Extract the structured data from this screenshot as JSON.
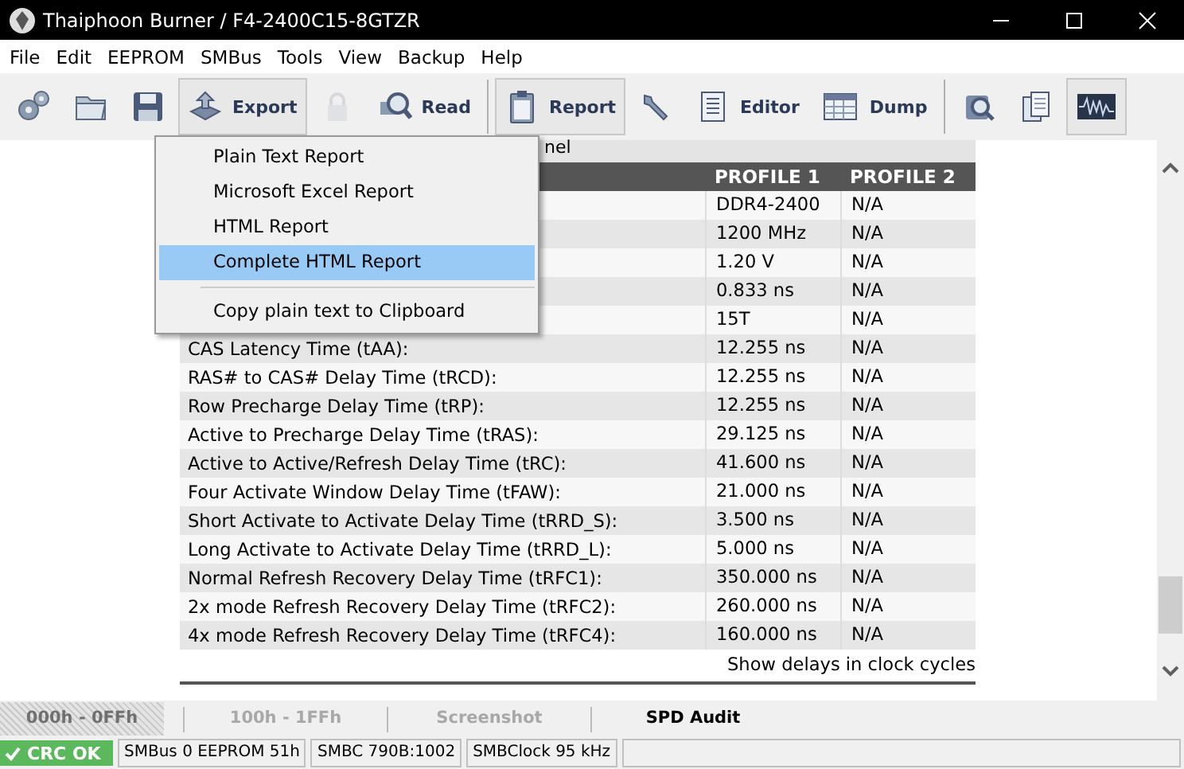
{
  "window": {
    "title": "Thaiphoon Burner / F4-2400C15-8GTZR"
  },
  "menu_bar": [
    "File",
    "Edit",
    "EEPROM",
    "SMBus",
    "Tools",
    "View",
    "Backup",
    "Help"
  ],
  "toolbar": [
    {
      "kind": "tool",
      "pressed": false,
      "disabled": false
    },
    {
      "kind": "tool",
      "pressed": false,
      "disabled": false
    },
    {
      "kind": "tool",
      "pressed": false,
      "disabled": false
    },
    {
      "kind": "labeled",
      "label": "Export",
      "pressed": true,
      "disabled": false
    },
    {
      "kind": "tool",
      "pressed": false,
      "disabled": true
    },
    {
      "kind": "labeled",
      "label": "Read",
      "pressed": false,
      "disabled": false
    },
    {
      "kind": "separator"
    },
    {
      "kind": "labeled",
      "label": "Report",
      "pressed": true,
      "disabled": false
    },
    {
      "kind": "tool",
      "pressed": false,
      "disabled": false
    },
    {
      "kind": "labeled",
      "label": "Editor",
      "pressed": false,
      "disabled": false
    },
    {
      "kind": "labeled",
      "label": "Dump",
      "pressed": false,
      "disabled": false
    },
    {
      "kind": "separator"
    },
    {
      "kind": "tool",
      "pressed": false,
      "disabled": false
    },
    {
      "kind": "tool",
      "pressed": false,
      "disabled": false
    },
    {
      "kind": "tool",
      "pressed": true,
      "disabled": false
    }
  ],
  "export_menu": [
    {
      "label": "Plain Text Report",
      "selected": false
    },
    {
      "label": "Microsoft Excel Report",
      "selected": false
    },
    {
      "label": "HTML Report",
      "selected": false
    },
    {
      "label": "Complete HTML Report",
      "selected": true
    },
    {
      "label": "Copy plain text to Clipboard",
      "selected": false,
      "separator_before": true
    }
  ],
  "report": {
    "section_title": "nel",
    "columns": [
      "PROFILE 1",
      "PROFILE 2"
    ],
    "rows": [
      {
        "profile_1": "DDR4-2400",
        "profile_2": "N/A"
      },
      {
        "profile_1": "1200 MHz",
        "profile_2": "N/A"
      },
      {
        "profile_1": "1.20 V",
        "profile_2": "N/A"
      },
      {
        "profile_1": "0.833 ns",
        "profile_2": "N/A"
      },
      {
        "profile_1": "15T",
        "profile_2": "N/A"
      },
      {
        "label": "CAS Latency Time (tAA):",
        "profile_1": "12.255 ns",
        "profile_2": "N/A"
      },
      {
        "label": "RAS# to CAS# Delay Time (tRCD):",
        "profile_1": "12.255 ns",
        "profile_2": "N/A"
      },
      {
        "label": "Row Precharge Delay Time (tRP):",
        "profile_1": "12.255 ns",
        "profile_2": "N/A"
      },
      {
        "label": "Active to Precharge Delay Time (tRAS):",
        "profile_1": "29.125 ns",
        "profile_2": "N/A"
      },
      {
        "label": "Active to Active/Refresh Delay Time (tRC):",
        "profile_1": "41.600 ns",
        "profile_2": "N/A"
      },
      {
        "label": "Four Activate Window Delay Time (tFAW):",
        "profile_1": "21.000 ns",
        "profile_2": "N/A"
      },
      {
        "label": "Short Activate to Activate Delay Time (tRRD_S):",
        "profile_1": "3.500 ns",
        "profile_2": "N/A"
      },
      {
        "label": "Long Activate to Activate Delay Time (tRRD_L):",
        "profile_1": "5.000 ns",
        "profile_2": "N/A"
      },
      {
        "label": "Normal Refresh Recovery Delay Time (tRFC1):",
        "profile_1": "350.000 ns",
        "profile_2": "N/A"
      },
      {
        "label": "2x mode Refresh Recovery Delay Time (tRFC2):",
        "profile_1": "260.000 ns",
        "profile_2": "N/A"
      },
      {
        "label": "4x mode Refresh Recovery Delay Time (tRFC4):",
        "profile_1": "160.000 ns",
        "profile_2": "N/A"
      }
    ],
    "footer_link": "Show delays in clock cycles"
  },
  "tabs": [
    {
      "label": "000h - 0FFh",
      "selected": false,
      "disabled": true
    },
    {
      "label": "100h - 1FFh",
      "selected": false,
      "disabled": false
    },
    {
      "label": "Screenshot",
      "selected": false,
      "disabled": false
    },
    {
      "label": "SPD Audit",
      "selected": true,
      "disabled": false
    }
  ],
  "status_bar": {
    "crc": "CRC OK",
    "crc_ok": true,
    "fields": [
      "SMBus 0 EEPROM 51h",
      "SMBC 790B:1002",
      "SMBClock 95 kHz"
    ]
  }
}
